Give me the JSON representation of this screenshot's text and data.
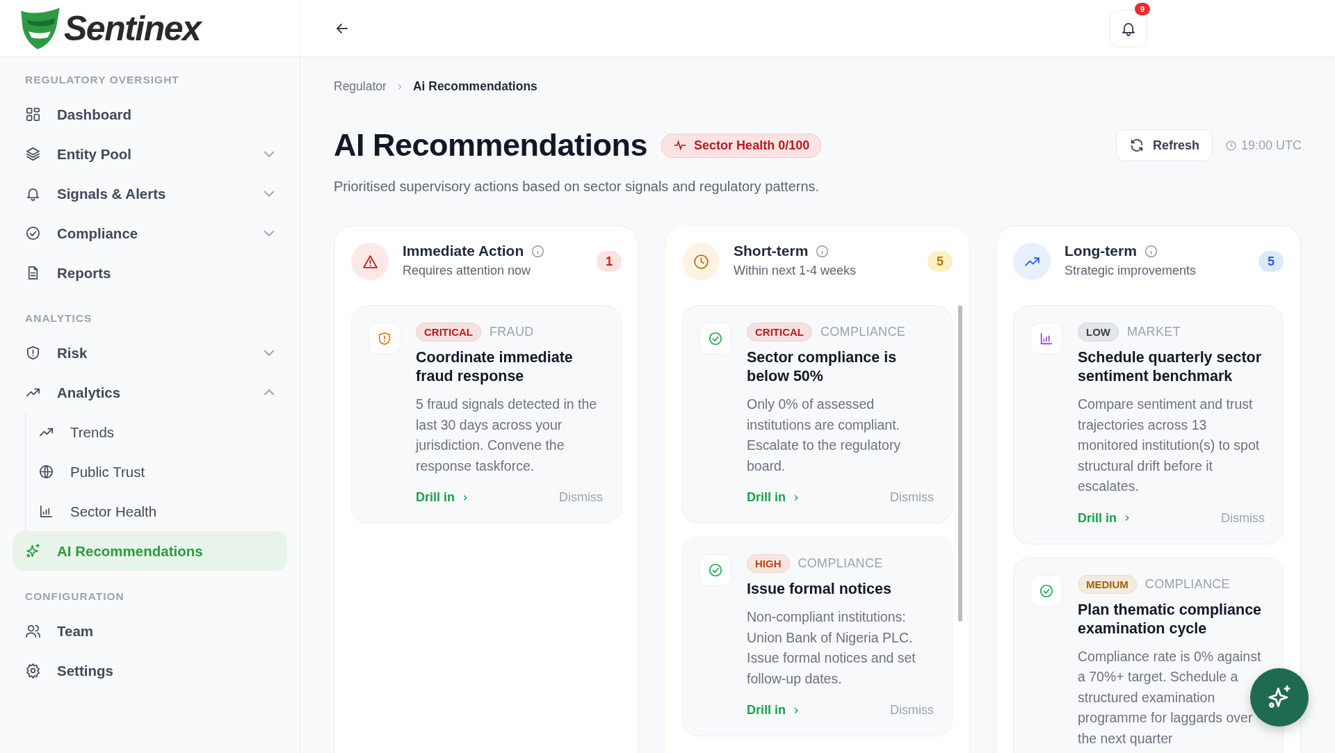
{
  "brand": {
    "name": "Sentinex"
  },
  "sidebar": {
    "sections": [
      {
        "label": "REGULATORY OVERSIGHT",
        "items": [
          {
            "label": "Dashboard",
            "selected": false
          },
          {
            "label": "Entity Pool",
            "selected": false,
            "expanded": false
          },
          {
            "label": "Signals & Alerts",
            "selected": false,
            "expanded": false
          },
          {
            "label": "Compliance",
            "selected": false,
            "expanded": false
          },
          {
            "label": "Reports",
            "selected": false
          }
        ]
      },
      {
        "label": "ANALYTICS",
        "items": [
          {
            "label": "Risk",
            "selected": false,
            "expanded": false
          },
          {
            "label": "Analytics",
            "selected": false,
            "expanded": true,
            "children": [
              {
                "label": "Trends",
                "selected": false
              },
              {
                "label": "Public Trust",
                "selected": false
              },
              {
                "label": "Sector Health",
                "selected": false
              }
            ]
          },
          {
            "label": "AI Recommendations",
            "selected": true
          }
        ]
      },
      {
        "label": "CONFIGURATION",
        "items": [
          {
            "label": "Team",
            "selected": false
          },
          {
            "label": "Settings",
            "selected": false
          }
        ]
      }
    ]
  },
  "topbar": {
    "notifications": "9"
  },
  "breadcrumb": [
    "Regulator",
    "Ai Recommendations"
  ],
  "page": {
    "title": "AI Recommendations",
    "health_badge": "Sector Health 0/100",
    "subtitle": "Prioritised supervisory actions based on sector signals and regulatory patterns.",
    "refresh": "Refresh",
    "time": "19:00 UTC"
  },
  "columns": [
    {
      "kind": "immediate",
      "title": "Immediate Action",
      "subtitle": "Requires attention now",
      "count": "1",
      "items": [
        {
          "kind": "shield",
          "badge": {
            "text": "CRITICAL",
            "color": "#b91c1c"
          },
          "category": "FRAUD",
          "title": "Coordinate immediate fraud response",
          "description": "5 fraud signals detected in the last 30 days across your jurisdiction. Convene the response taskforce.",
          "link": "Drill in",
          "dismiss": "Dismiss"
        }
      ]
    },
    {
      "kind": "short",
      "title": "Short-term",
      "subtitle": "Within next 1-4 weeks",
      "count": "5",
      "items": [
        {
          "kind": "check",
          "badge": {
            "text": "CRITICAL",
            "color": "#b91c1c"
          },
          "category": "COMPLIANCE",
          "title": "Sector compliance is below 50%",
          "description": "Only 0% of assessed institutions are compliant. Escalate to the regulatory board.",
          "link": "Drill in",
          "dismiss": "Dismiss"
        },
        {
          "kind": "check",
          "badge": {
            "text": "HIGH",
            "color": "#c2410c"
          },
          "category": "COMPLIANCE",
          "title": "Issue formal notices",
          "description": "Non-compliant institutions: Union Bank of Nigeria PLC. Issue formal notices and set follow-up dates.",
          "link": "Drill in",
          "dismiss": "Dismiss"
        }
      ]
    },
    {
      "kind": "long",
      "title": "Long-term",
      "subtitle": "Strategic improvements",
      "count": "5",
      "items": [
        {
          "kind": "chart",
          "badge": {
            "text": "LOW",
            "color": "#374151"
          },
          "category": "MARKET",
          "title": "Schedule quarterly sector sentiment benchmark",
          "description": "Compare sentiment and trust trajectories across 13 monitored institution(s) to spot structural drift before it escalates.",
          "link": "Drill in",
          "dismiss": "Dismiss"
        },
        {
          "kind": "check",
          "badge": {
            "text": "MEDIUM",
            "color": "#a16207"
          },
          "category": "COMPLIANCE",
          "title": "Plan thematic compliance examination cycle",
          "description": "Compliance rate is 0% against a 70%+ target. Schedule a structured examination programme for laggards over the next quarter"
        }
      ]
    }
  ]
}
